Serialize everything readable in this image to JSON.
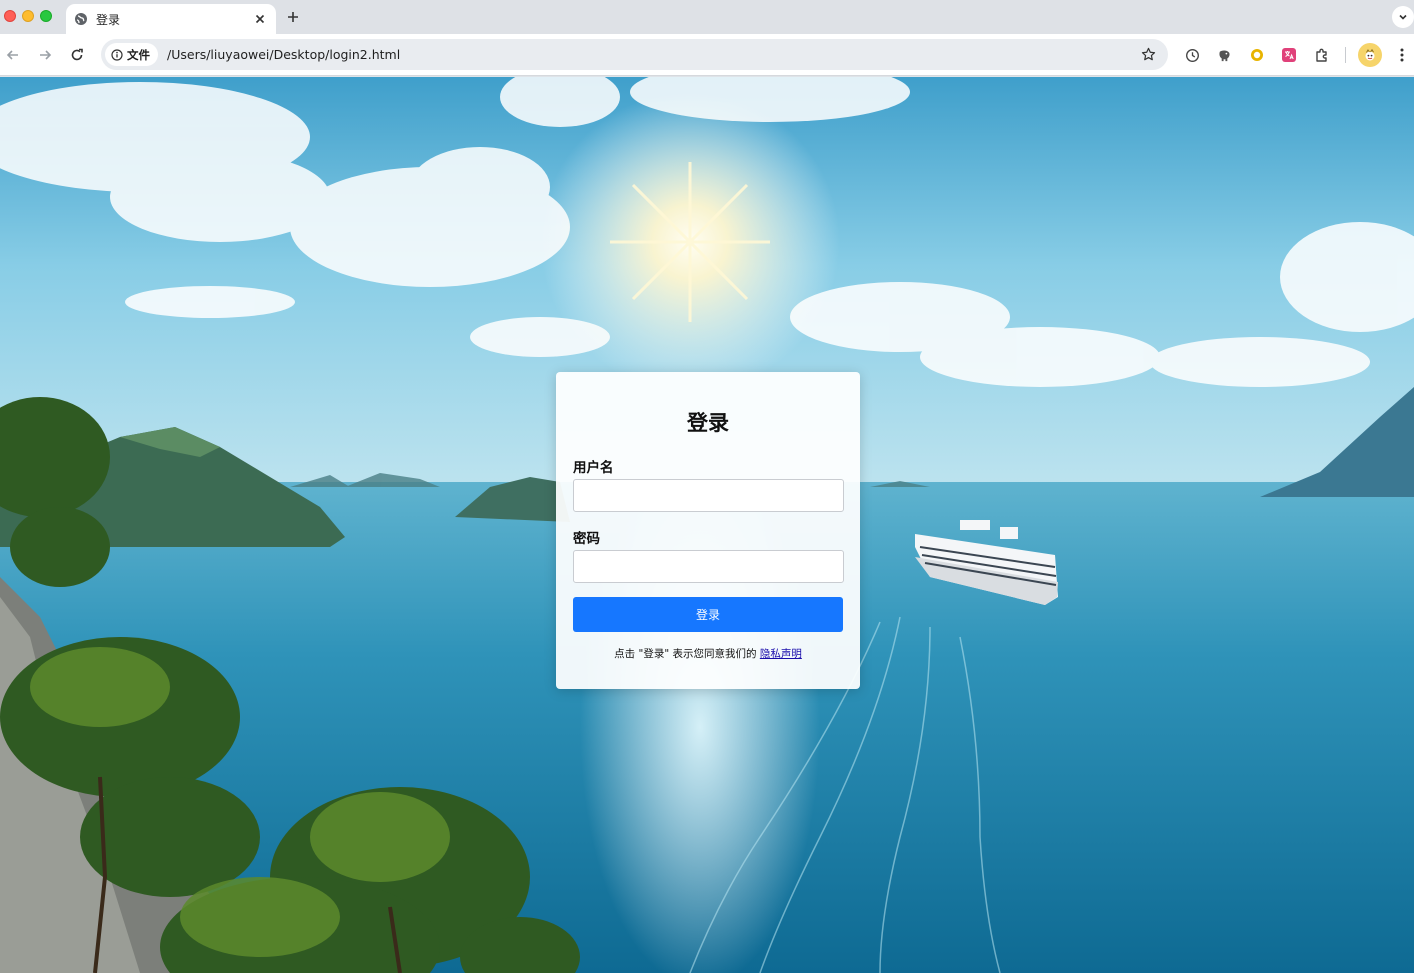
{
  "browser": {
    "tab": {
      "title": "登录"
    },
    "address_bar": {
      "security_chip": "文件",
      "url": "/Users/liuyaowei/Desktop/login2.html"
    },
    "icons": {
      "favicon": "globe-icon",
      "close": "close-icon",
      "new_tab": "plus-icon",
      "back": "arrow-left-icon",
      "forward": "arrow-right-icon",
      "reload": "reload-icon",
      "info": "info-icon",
      "bookmark": "star-icon",
      "extensions": [
        "history-icon",
        "elephant-icon",
        "ring-icon",
        "translate-icon",
        "puzzle-icon"
      ],
      "profile": "profile-avatar",
      "menu": "more-vert-icon"
    }
  },
  "login": {
    "title": "登录",
    "username_label": "用户名",
    "username_value": "",
    "password_label": "密码",
    "password_value": "",
    "submit_label": "登录",
    "agreement_text": "点击 \"登录\" 表示您同意我们的 ",
    "privacy_link": "隐私声明"
  },
  "colors": {
    "primary_button": "#1677ff",
    "link": "#1a0dab",
    "sky": "#5fb3d6",
    "sea": "#2a8fb4"
  }
}
